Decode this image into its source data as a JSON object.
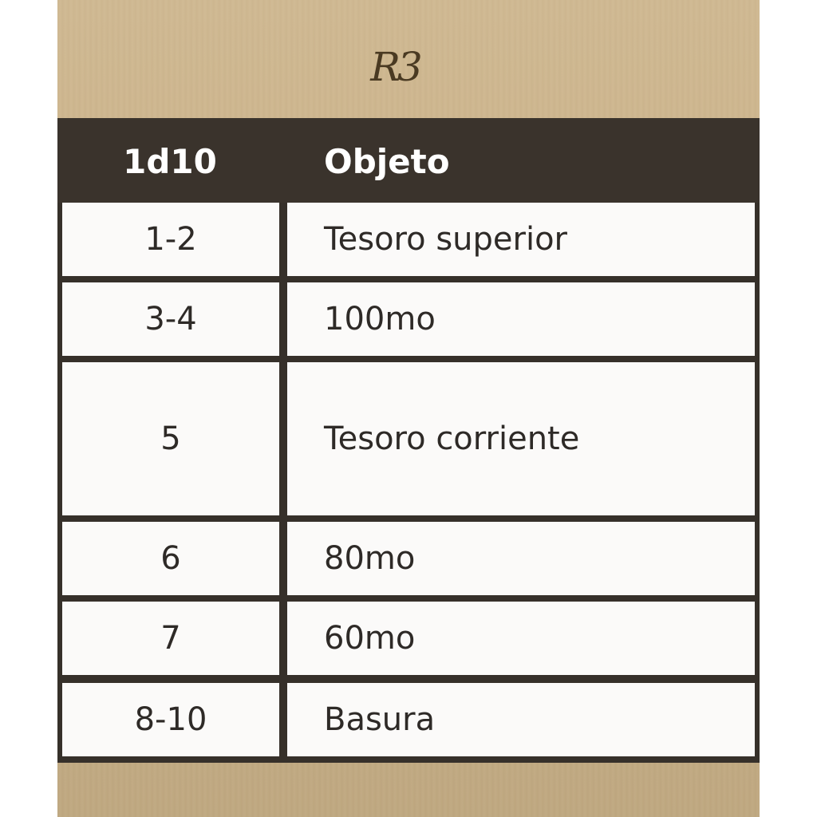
{
  "logo": {
    "text": "R3"
  },
  "table": {
    "headers": [
      "1d10",
      "Objeto"
    ],
    "rows": [
      {
        "roll": "1-2",
        "item": "Tesoro superior"
      },
      {
        "roll": "3-4",
        "item": "100mo"
      },
      {
        "roll": "5",
        "item": "Tesoro corriente"
      },
      {
        "roll": "6",
        "item": "80mo"
      },
      {
        "roll": "7",
        "item": "60mo"
      },
      {
        "roll": "8-10",
        "item": "Basura"
      }
    ]
  },
  "colors": {
    "card_background": "#cdb58c",
    "header_background": "#3a332c",
    "cell_background": "#fbfaf9",
    "text": "#2e2a27"
  }
}
